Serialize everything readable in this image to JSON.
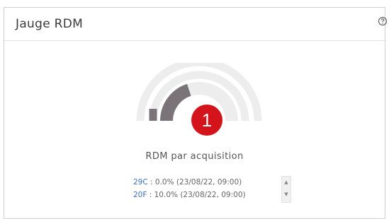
{
  "widget": {
    "title": "Jauge RDM",
    "help_icon": "help-circle-icon"
  },
  "gauge": {
    "level": 0.4,
    "label": "RDM par acquisition",
    "colors": {
      "track": "#ededed",
      "fill": "#7a7479"
    },
    "marker": {
      "text": "1",
      "color": "#d4141b"
    }
  },
  "acquisitions": [
    {
      "code": "29C",
      "detail": " : 0.0% (23/08/22, 09:00)"
    },
    {
      "code": "20F",
      "detail": " : 10.0% (23/08/22, 09:00)"
    }
  ],
  "scroll_icons": {
    "up": "scroll-up-icon",
    "down": "scroll-down-icon"
  }
}
